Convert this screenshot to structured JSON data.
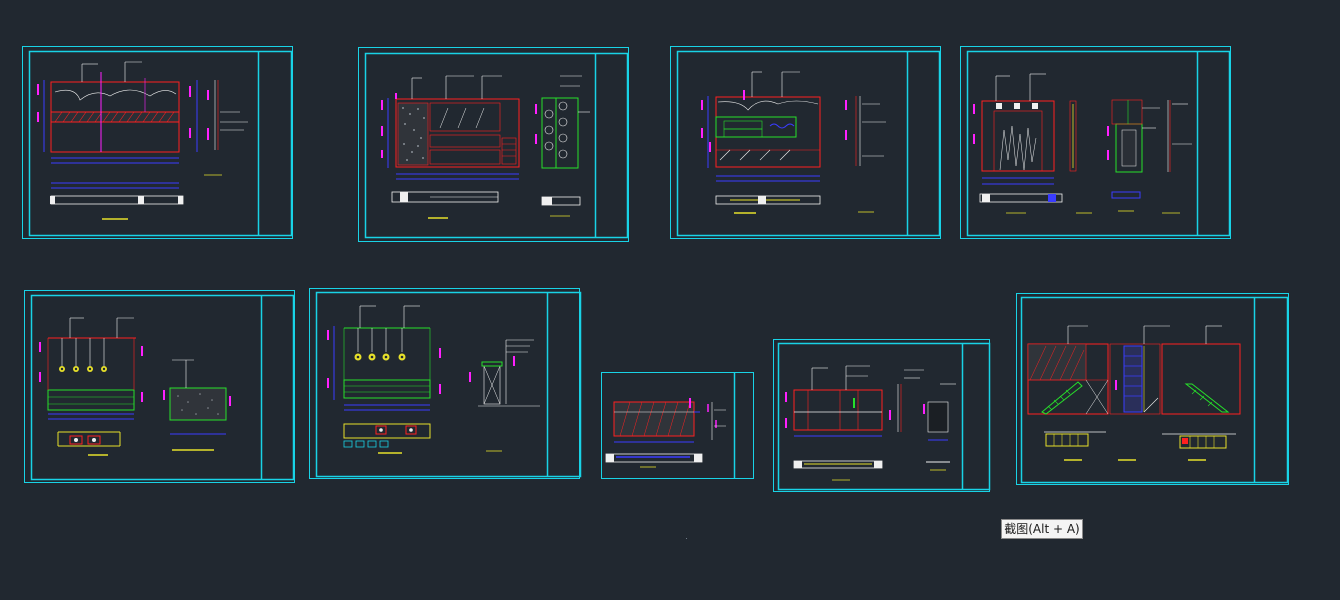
{
  "app": {
    "background_color": "#212830"
  },
  "colors": {
    "frame": "#19d3e6",
    "outline_red": "#ff2020",
    "magenta": "#ff20ff",
    "blue": "#3a3cff",
    "green": "#27e02a",
    "yellow": "#e6e02a",
    "white": "#f0f0f0",
    "gray": "#6a7784"
  },
  "tooltip": {
    "text": "截图(Alt + A)"
  },
  "sheets": [
    {
      "id": "sheet-1",
      "kind": "ceiling-elevation"
    },
    {
      "id": "sheet-2",
      "kind": "cabinet-elevation"
    },
    {
      "id": "sheet-3",
      "kind": "counter-elevation"
    },
    {
      "id": "sheet-4",
      "kind": "door-elevation"
    },
    {
      "id": "sheet-5",
      "kind": "pendant-elevation"
    },
    {
      "id": "sheet-6",
      "kind": "bar-elevation"
    },
    {
      "id": "sheet-7",
      "kind": "panel-elevation"
    },
    {
      "id": "sheet-8",
      "kind": "wall-elevation"
    },
    {
      "id": "sheet-9",
      "kind": "stair-elevation"
    }
  ]
}
